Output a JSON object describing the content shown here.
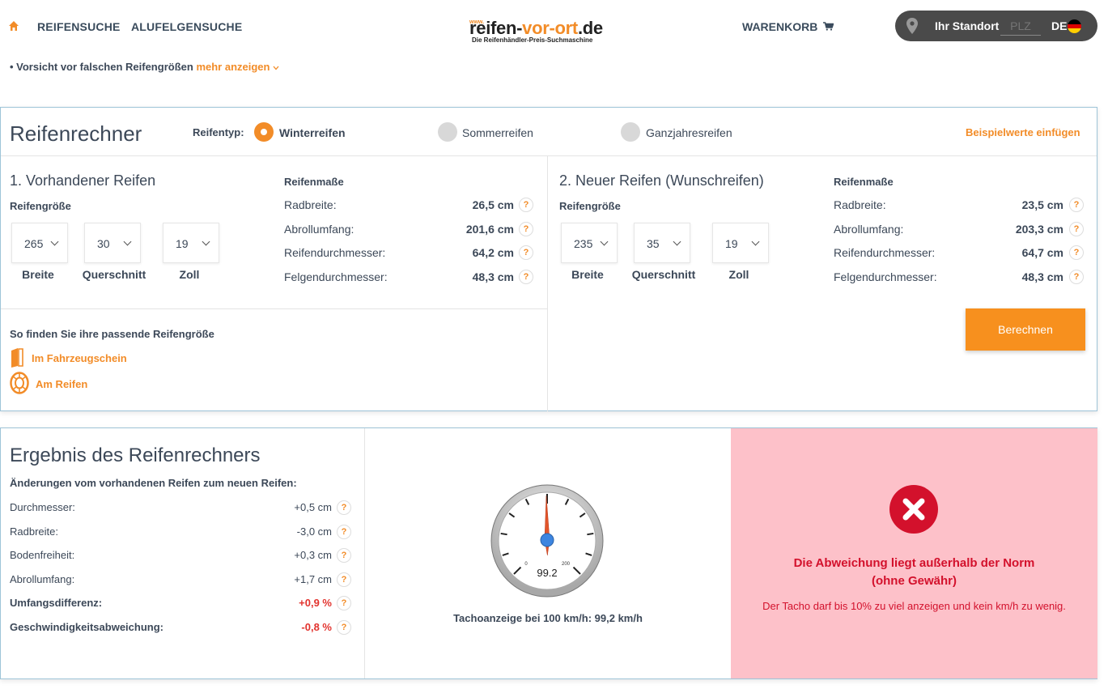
{
  "nav": {
    "links": [
      "REIFENSUCHE",
      "ALUFELGENSUCHE"
    ],
    "cart_label": "WARENKORB",
    "logo": {
      "www": "www.",
      "name_a": "reifen-",
      "name_b": "vor-ort",
      "name_c": ".de",
      "tagline": "Die Reifenhändler-Preis-Suchmaschine"
    },
    "location_label": "Ihr Standort",
    "plz_placeholder": "PLZ",
    "language": "DE"
  },
  "warning": {
    "text": "• Vorsicht vor falschen Reifengrößen",
    "more": "mehr anzeigen"
  },
  "calculator": {
    "title": "Reifenrechner",
    "tire_type_label": "Reifentyp:",
    "tire_types": [
      "Winterreifen",
      "Sommerreifen",
      "Ganzjahresreifen"
    ],
    "selected_type": "Winterreifen",
    "sample_link": "Beispielwerte einfügen",
    "old_tire": {
      "title": "1. Vorhandener Reifen",
      "size_label": "Reifengröße",
      "width": "265",
      "profile": "30",
      "rim": "19",
      "width_label": "Breite",
      "profile_label": "Querschnitt",
      "rim_label": "Zoll",
      "measures_title": "Reifenmaße",
      "measures": [
        {
          "label": "Radbreite:",
          "value": "26,5 cm"
        },
        {
          "label": "Abrollumfang:",
          "value": "201,6 cm"
        },
        {
          "label": "Reifendurchmesser:",
          "value": "64,2 cm"
        },
        {
          "label": "Felgendurchmesser:",
          "value": "48,3 cm"
        }
      ]
    },
    "new_tire": {
      "title": "2. Neuer Reifen (Wunschreifen)",
      "size_label": "Reifengröße",
      "width": "235",
      "profile": "35",
      "rim": "19",
      "width_label": "Breite",
      "profile_label": "Querschnitt",
      "rim_label": "Zoll",
      "measures_title": "Reifenmaße",
      "measures": [
        {
          "label": "Radbreite:",
          "value": "23,5 cm"
        },
        {
          "label": "Abrollumfang:",
          "value": "203,3 cm"
        },
        {
          "label": "Reifendurchmesser:",
          "value": "64,7 cm"
        },
        {
          "label": "Felgendurchmesser:",
          "value": "48,3 cm"
        }
      ]
    },
    "howto_title": "So finden Sie ihre passende Reifengröße",
    "howto_links": [
      "Im Fahrzeugschein",
      "Am Reifen"
    ],
    "calc_button": "Berechnen",
    "help_glyph": "?"
  },
  "result": {
    "title": "Ergebnis des Reifenrechners",
    "subtitle": "Änderungen vom vorhandenen Reifen zum neuen Reifen:",
    "rows": [
      {
        "label": "Durchmesser:",
        "value": "+0,5 cm"
      },
      {
        "label": "Radbreite:",
        "value": "-3,0 cm"
      },
      {
        "label": "Bodenfreiheit:",
        "value": "+0,3 cm"
      },
      {
        "label": "Abrollumfang:",
        "value": "+1,7 cm"
      },
      {
        "label": "Umfangsdifferenz:",
        "value": "+0,9 %"
      },
      {
        "label": "Geschwindigkeitsabweichung:",
        "value": "-0,8 %"
      }
    ],
    "gauge": {
      "min_label": "0",
      "max_label": "200",
      "reading": "99.2",
      "max": 200
    },
    "tacho_text": "Tachoanzeige bei 100 km/h: 99,2 km/h",
    "error_title_1": "Die Abweichung liegt außerhalb der Norm",
    "error_title_2": "(ohne Gewähr)",
    "error_text": "Der Tacho darf bis 10% zu viel anzeigen und kein km/h zu wenig.",
    "colors": {
      "accent": "#f28c28",
      "error": "#d3112c",
      "error_bg": "#fdc1c9",
      "negative": "#e2332e"
    }
  }
}
